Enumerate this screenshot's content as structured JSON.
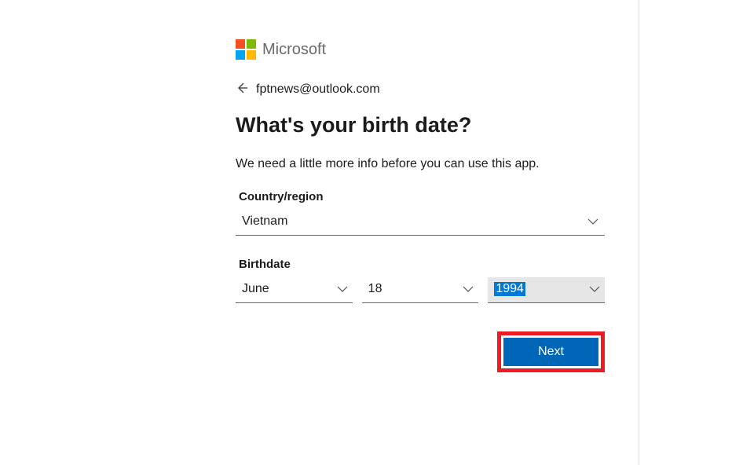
{
  "brand": {
    "name": "Microsoft"
  },
  "email": "fptnews@outlook.com",
  "title": "What's your birth date?",
  "subtitle": "We need a little more info before you can use this app.",
  "country": {
    "label": "Country/region",
    "value": "Vietnam"
  },
  "birthdate": {
    "label": "Birthdate",
    "month": "June",
    "day": "18",
    "year": "1994"
  },
  "buttons": {
    "next": "Next"
  }
}
